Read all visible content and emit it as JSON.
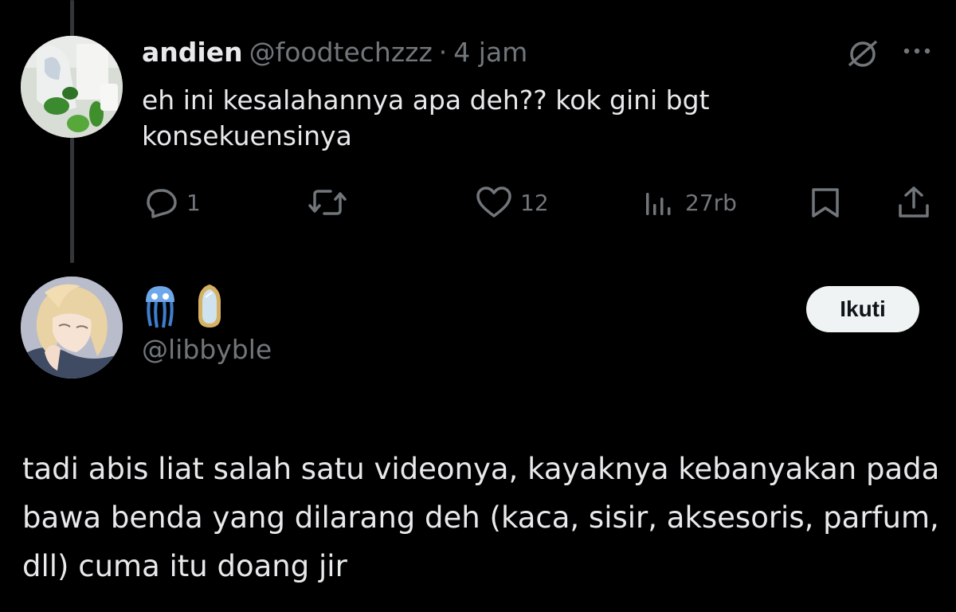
{
  "thread": {
    "parent": {
      "author_name": "andien",
      "handle": "@foodtechzzz",
      "separator": "·",
      "time": "4 jam",
      "text": "eh ini kesalahannya apa deh?? kok gini bgt konsekuensinya",
      "actions": {
        "reply_count": "1",
        "retweet_count": "",
        "like_count": "12",
        "view_count": "27rb"
      },
      "icons": [
        "grok-icon",
        "more-icon",
        "reply-icon",
        "retweet-icon",
        "like-icon",
        "views-icon",
        "bookmark-icon",
        "share-icon"
      ]
    },
    "reply": {
      "display_name_icons": [
        "jellyfish-emoji",
        "mirror-emoji"
      ],
      "handle": "@libbyble",
      "follow_label": "Ikuti",
      "text": "tadi abis liat salah satu videonya, kayaknya kebanyakan pada bawa benda yang dilarang deh (kaca, sisir, aksesoris, parfum, dll) cuma itu doang jir"
    }
  },
  "colors": {
    "background": "#000000",
    "primary_text": "#e7e9ea",
    "secondary_text": "#71767b",
    "thread_line": "#333639",
    "follow_button_bg": "#eff3f4",
    "follow_button_text": "#0f1419"
  }
}
